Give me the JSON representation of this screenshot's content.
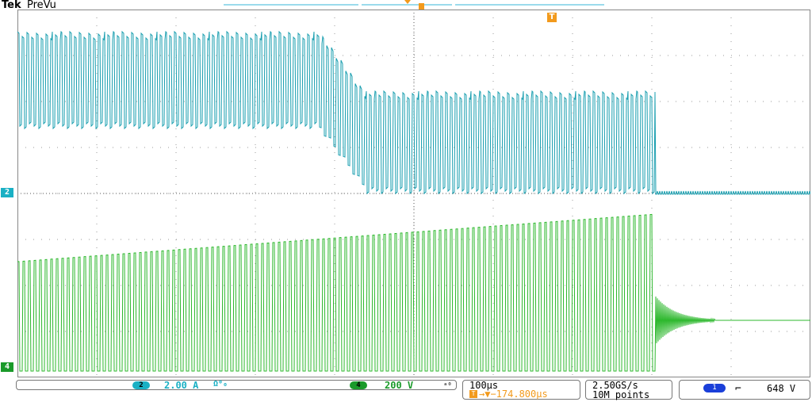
{
  "header": {
    "brand": "Tek",
    "mode": "PreVu"
  },
  "markers": {
    "ch2_ground": "2",
    "ch4_ground": "4",
    "trigger_top": "T"
  },
  "channels": [
    {
      "num": "2",
      "scale": "2.00 A",
      "suffix": "Ω⁰₀",
      "color": "#1ab0c4"
    },
    {
      "num": "4",
      "scale": "200 V",
      "suffix": "ₐ₀",
      "color": "#1a9a2a"
    }
  ],
  "timebase": {
    "scale": "100µs",
    "trigger_pos": "→▼−174.800µs"
  },
  "sampling": {
    "rate": "2.50GS/s",
    "record": "10M points"
  },
  "trigger": {
    "source": "1",
    "slope": "⌐",
    "level": "648 V"
  },
  "colors": {
    "ch2": "#1a9fb0",
    "ch4": "#2db82d",
    "trigger": "#f29a1c",
    "grid": "#999999"
  }
}
